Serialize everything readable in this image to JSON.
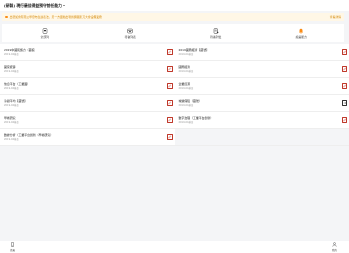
{
  "header": {
    "title": "(研製) 現行最佳得益預守前任能力"
  },
  "notice": {
    "text": "出發如會有限公學發布生說表法，另一方面動出現將鋼鐵影刀大會設備業務",
    "link": "查看詳情"
  },
  "tabs": [
    {
      "label": "全部列",
      "icon": "card-icon"
    },
    {
      "label": "待審列表",
      "icon": "inbox-icon"
    },
    {
      "label": "待審列位",
      "icon": "document-icon"
    },
    {
      "label": "總是能力",
      "icon": "bell-icon",
      "accent": "#fa8c16"
    }
  ],
  "rows": [
    [
      {
        "name": "2019中國民族力（藏檔",
        "sub": "2019-04基金",
        "action": "red"
      },
      {
        "name": "2019國際經濟【藏號】",
        "sub": "2019-04基金",
        "action": "red"
      }
    ],
    [
      {
        "name": "國家統籌",
        "sub": "2019-04基金",
        "action": "red"
      },
      {
        "name": "國際經濟",
        "sub": "2019-04基金",
        "action": "red"
      }
    ],
    [
      {
        "name": "信息平台（工業園）",
        "sub": "2019-04基金",
        "action": "red"
      },
      {
        "name": "企業資源",
        "sub": "2019-04基金",
        "action": "red"
      }
    ],
    [
      {
        "name": "冷鏈平均【藏號】",
        "sub": "2019-04基金",
        "action": "red"
      },
      {
        "name": "城鎮保障（藏號）",
        "sub": "2019-04基金",
        "action": "dark"
      }
    ],
    [
      {
        "name": "學術研究",
        "sub": "2019-04基金",
        "action": "red"
      },
      {
        "name": "數字治理（工業平台創新）",
        "sub": "2019-04基金",
        "action": "red"
      }
    ],
    [
      {
        "name": "數據分析（工業平台創新（學術研究）",
        "sub": "2019-04基金",
        "action": "red"
      },
      null
    ]
  ],
  "bottom_nav": [
    {
      "label": "首頁",
      "icon": "phone-icon"
    },
    {
      "label": "我的",
      "icon": "user-icon"
    }
  ],
  "colors": {
    "accent": "#fa8c16",
    "action_red": "#c0392b",
    "notice_bg": "#fff7e6"
  }
}
